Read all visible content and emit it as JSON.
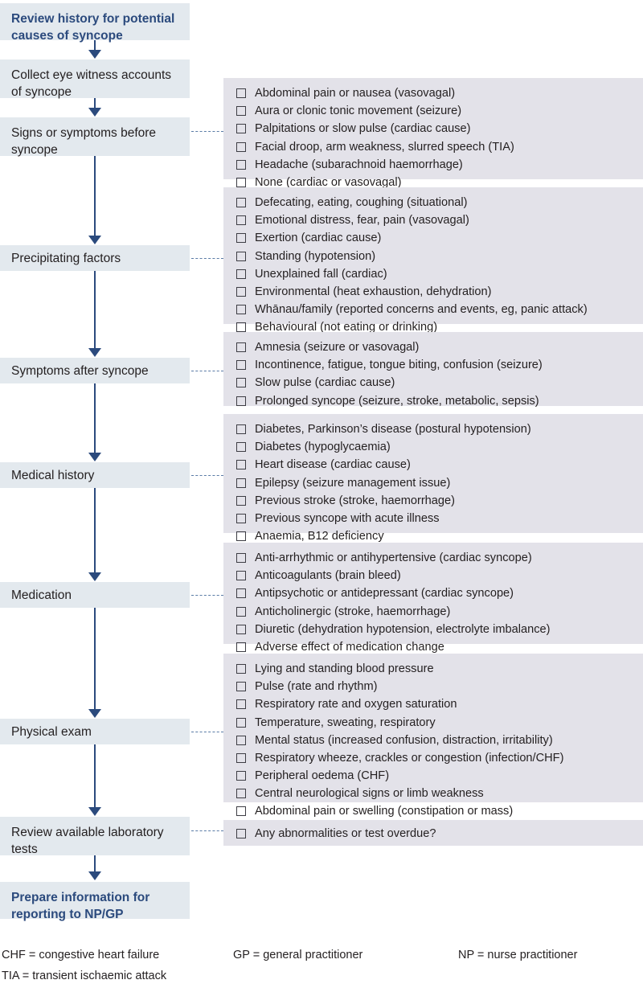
{
  "title": "Review history for potential causes of syncope flowchart",
  "colors": {
    "accent": "#2b4a7d",
    "process_box_bg": "#e3e9ee",
    "panel_bg": "#e3e2e9",
    "text": "#231f20",
    "leader_line": "#5a7ba6"
  },
  "steps": [
    {
      "id": "review-history",
      "label": "Review history for potential causes of syncope",
      "emphasis": true
    },
    {
      "id": "collect-eye-witness",
      "label": "Collect eye witness accounts of syncope",
      "emphasis": false
    },
    {
      "id": "signs-symptoms-before",
      "label": "Signs or symptoms before syncope",
      "emphasis": false
    },
    {
      "id": "precipitating-factors",
      "label": "Precipitating factors",
      "emphasis": false
    },
    {
      "id": "symptoms-after",
      "label": "Symptoms after syncope",
      "emphasis": false
    },
    {
      "id": "medical-history",
      "label": "Medical history",
      "emphasis": false
    },
    {
      "id": "medication",
      "label": "Medication",
      "emphasis": false
    },
    {
      "id": "physical-exam",
      "label": "Physical exam",
      "emphasis": false
    },
    {
      "id": "review-lab-tests",
      "label": "Review available laboratory tests",
      "emphasis": false
    },
    {
      "id": "prepare-information",
      "label": "Prepare information for reporting to NP/GP",
      "emphasis": true
    }
  ],
  "panels": [
    {
      "id": "signs-symptoms-before",
      "items": [
        "Abdominal pain or nausea (vasovagal)",
        "Aura or clonic tonic movement (seizure)",
        "Palpitations or slow pulse (cardiac cause)",
        "Facial droop, arm weakness, slurred speech (TIA)",
        "Headache (subarachnoid haemorrhage)",
        "None (cardiac or vasovagal)"
      ]
    },
    {
      "id": "precipitating-factors",
      "items": [
        "Defecating, eating, coughing (situational)",
        "Emotional distress, fear, pain (vasovagal)",
        "Exertion (cardiac cause)",
        "Standing (hypotension)",
        "Unexplained fall (cardiac)",
        "Environmental (heat exhaustion, dehydration)",
        "Whānau/family (reported concerns and events, eg, panic attack)",
        "Behavioural (not eating or drinking)"
      ]
    },
    {
      "id": "symptoms-after",
      "items": [
        "Amnesia (seizure or vasovagal)",
        "Incontinence, fatigue, tongue biting, confusion (seizure)",
        "Slow pulse (cardiac cause)",
        "Prolonged syncope (seizure, stroke, metabolic, sepsis)"
      ]
    },
    {
      "id": "medical-history",
      "items": [
        "Diabetes, Parkinson’s disease (postural hypotension)",
        "Diabetes (hypoglycaemia)",
        "Heart disease (cardiac cause)",
        "Epilepsy (seizure management issue)",
        "Previous stroke (stroke, haemorrhage)",
        "Previous syncope with acute illness",
        "Anaemia, B12 deficiency"
      ]
    },
    {
      "id": "medication",
      "items": [
        "Anti-arrhythmic or antihypertensive (cardiac syncope)",
        "Anticoagulants (brain bleed)",
        "Antipsychotic or antidepressant (cardiac syncope)",
        "Anticholinergic (stroke, haemorrhage)",
        "Diuretic (dehydration hypotension, electrolyte imbalance)",
        "Adverse effect of medication change"
      ]
    },
    {
      "id": "physical-exam",
      "items": [
        "Lying and standing blood pressure",
        "Pulse (rate and rhythm)",
        "Respiratory rate and oxygen saturation",
        "Temperature, sweating, respiratory",
        "Mental status (increased confusion, distraction, irritability)",
        "Respiratory wheeze, crackles or congestion (infection/CHF)",
        "Peripheral oedema (CHF)",
        "Central neurological signs or limb weakness",
        "Abdominal pain or swelling (constipation or mass)"
      ]
    },
    {
      "id": "review-lab-tests",
      "items": [
        "Any abnormalities or test overdue?"
      ]
    }
  ],
  "legend": [
    "CHF = congestive heart failure",
    "TIA = transient ischaemic attack",
    "GP = general practitioner",
    "NP = nurse practitioner"
  ]
}
